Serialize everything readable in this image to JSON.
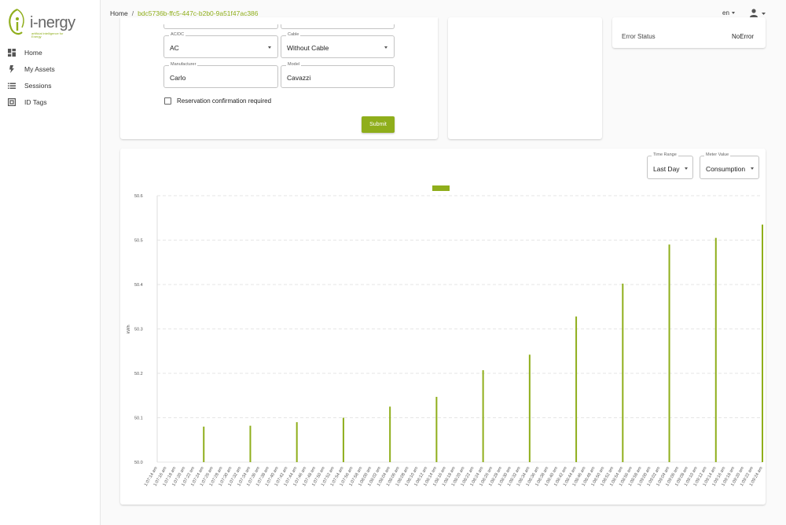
{
  "brand": {
    "logo_text": "i-nergy",
    "tagline": "artificial intelligence for Energy",
    "accent_color": "#8fae1b"
  },
  "sidebar": {
    "items": [
      {
        "label": "Home",
        "icon": "dashboard-icon"
      },
      {
        "label": "My Assets",
        "icon": "bolt-icon"
      },
      {
        "label": "Sessions",
        "icon": "list-icon"
      },
      {
        "label": "ID Tags",
        "icon": "tag-icon"
      }
    ]
  },
  "header": {
    "breadcrumb_home": "Home",
    "breadcrumb_sep": "/",
    "breadcrumb_current": "bdc5736b-ffc5-447c-b2b0-9a51f47ac386",
    "language": "en"
  },
  "form": {
    "acdc_label": "AC/DC",
    "acdc_value": "AC",
    "cable_label": "Cable",
    "cable_value": "Without Cable",
    "manufacturer_label": "Manufacturer",
    "manufacturer_value": "Carlo",
    "model_label": "Model",
    "model_value": "Cavazzi",
    "reservation_label": "Reservation confirmation required",
    "reservation_checked": false,
    "submit_label": "Submit"
  },
  "status": {
    "label": "Error Status",
    "value": "NoError"
  },
  "chart_controls": {
    "time_range_label": "Time Range",
    "time_range_value": "Last Day",
    "meter_value_label": "Meter Value",
    "meter_value_value": "Consumption"
  },
  "chart_data": {
    "type": "bar",
    "color": "#8fae1b",
    "ylabel": "kWh",
    "ylim": [
      50.0,
      50.6
    ],
    "yticks": [
      "50.0",
      "50.1",
      "50.2",
      "50.3",
      "50.4",
      "50.5",
      "50.6"
    ],
    "grid": true,
    "categories": [
      "1:07:14 am",
      "1:07:16 am",
      "1:07:18 am",
      "1:07:20 am",
      "1:07:22 am",
      "1:07:24 am",
      "1:07:26 am",
      "1:07:28 am",
      "1:07:30 am",
      "1:07:32 am",
      "1:07:34 am",
      "1:07:36 am",
      "1:07:38 am",
      "1:07:40 am",
      "1:07:42 am",
      "1:07:44 am",
      "1:07:46 am",
      "1:07:48 am",
      "1:07:50 am",
      "1:07:52 am",
      "1:07:54 am",
      "1:07:56 am",
      "1:07:58 am",
      "1:08:00 am",
      "1:08:02 am",
      "1:08:04 am",
      "1:08:06 am",
      "1:08:08 am",
      "1:08:10 am",
      "1:08:12 am",
      "1:08:14 am",
      "1:08:16 am",
      "1:08:18 am",
      "1:08:20 am",
      "1:08:22 am",
      "1:08:24 am",
      "1:08:26 am",
      "1:08:28 am",
      "1:08:30 am",
      "1:08:32 am",
      "1:08:34 am",
      "1:08:36 am",
      "1:08:38 am",
      "1:08:40 am",
      "1:08:42 am",
      "1:08:44 am",
      "1:08:46 am",
      "1:08:48 am",
      "1:08:50 am",
      "1:08:52 am",
      "1:08:54 am",
      "1:08:56 am",
      "1:08:58 am",
      "1:09:00 am",
      "1:09:02 am",
      "1:09:04 am",
      "1:09:06 am",
      "1:09:08 am",
      "1:09:10 am",
      "1:09:12 am",
      "1:09:14 am",
      "1:09:16 am",
      "1:09:18 am",
      "1:09:20 am",
      "1:09:22 am",
      "1:09:24 am"
    ],
    "values": [
      0,
      0,
      0,
      0,
      0,
      50.08,
      0,
      0,
      0,
      0,
      50.082,
      0,
      0,
      0,
      0,
      50.09,
      0,
      0,
      0,
      0,
      50.1,
      0,
      0,
      0,
      0,
      50.125,
      0,
      0,
      0,
      0,
      50.147,
      0,
      0,
      0,
      0,
      50.207,
      0,
      0,
      0,
      0,
      50.242,
      0,
      0,
      0,
      0,
      50.328,
      0,
      0,
      0,
      0,
      50.402,
      0,
      0,
      0,
      0,
      50.49,
      0,
      0,
      0,
      0,
      50.505,
      0,
      0,
      0,
      0,
      50.535
    ]
  }
}
